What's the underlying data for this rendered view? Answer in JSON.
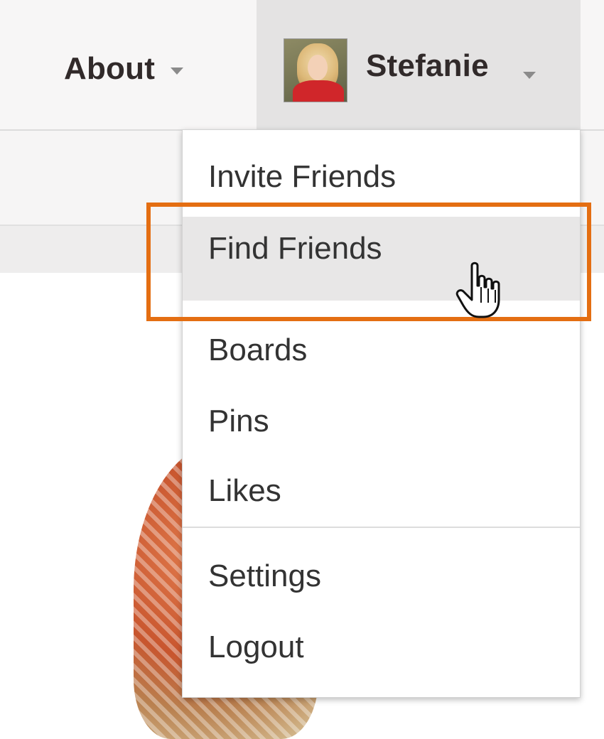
{
  "nav": {
    "about_label": "About",
    "user_label": "Stefanie"
  },
  "user_menu": {
    "items": [
      {
        "label": "Invite Friends"
      },
      {
        "label": "Find Friends"
      },
      {
        "label": "Boards"
      },
      {
        "label": "Pins"
      },
      {
        "label": "Likes"
      },
      {
        "label": "Settings"
      },
      {
        "label": "Logout"
      }
    ],
    "hovered": "Find Friends"
  },
  "colors": {
    "highlight": "#e46e12",
    "hover_background": "#e8e7e7",
    "nav_text": "#312a2a"
  }
}
